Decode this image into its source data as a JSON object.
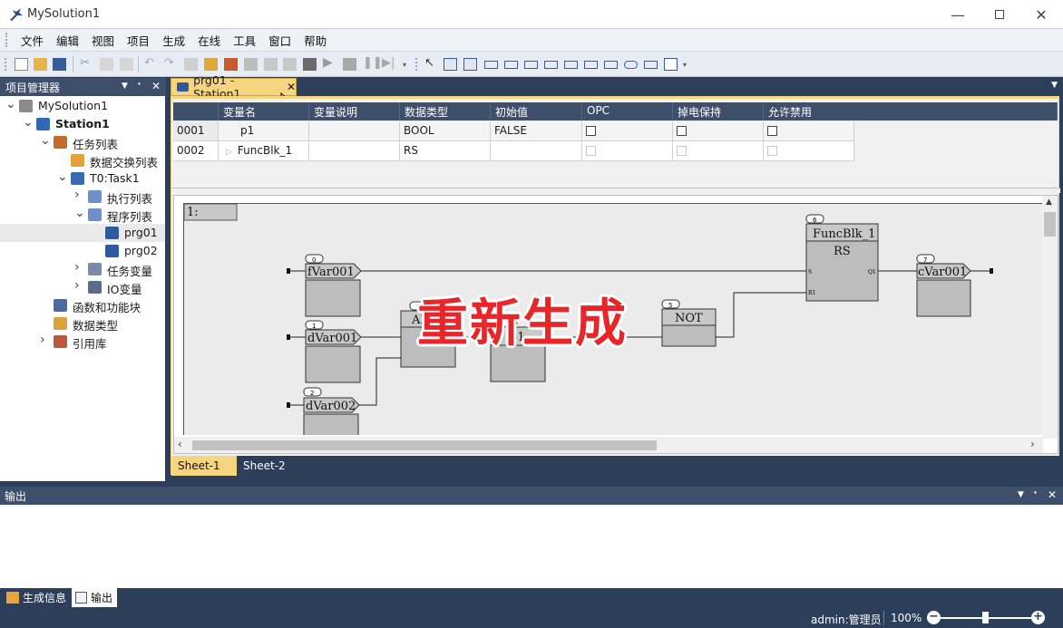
{
  "window": {
    "title": "MySolution1"
  },
  "menu": [
    "文件",
    "编辑",
    "视图",
    "项目",
    "生成",
    "在线",
    "工具",
    "窗口",
    "帮助"
  ],
  "project_panel": {
    "title": "项目管理器",
    "tree": [
      {
        "label": "MySolution1",
        "icon": "solution-icon",
        "bold": false
      },
      {
        "label": "Station1",
        "icon": "station-icon",
        "bold": true
      },
      {
        "label": "任务列表",
        "icon": "task-list-icon",
        "bold": false
      },
      {
        "label": "数据交换列表",
        "icon": "data-exchange-icon",
        "bold": false
      },
      {
        "label": "T0:Task1",
        "icon": "task-icon",
        "bold": false
      },
      {
        "label": "执行列表",
        "icon": "exec-list-icon",
        "bold": false
      },
      {
        "label": "程序列表",
        "icon": "program-list-icon",
        "bold": false
      },
      {
        "label": "prg01",
        "icon": "program-icon",
        "bold": false
      },
      {
        "label": "prg02",
        "icon": "program-icon",
        "bold": false
      },
      {
        "label": "任务变量",
        "icon": "task-variable-icon",
        "bold": false
      },
      {
        "label": "IO变量",
        "icon": "io-variable-icon",
        "bold": false
      },
      {
        "label": "函数和功能块",
        "icon": "function-block-icon",
        "bold": false
      },
      {
        "label": "数据类型",
        "icon": "data-type-icon",
        "bold": false
      },
      {
        "label": "引用库",
        "icon": "library-icon",
        "bold": false
      }
    ]
  },
  "document": {
    "tab_label": "prg01 - Station1",
    "var_table": {
      "headers": [
        "变量名",
        "变量说明",
        "数据类型",
        "初始值",
        "OPC",
        "掉电保持",
        "允许禁用"
      ],
      "rows": [
        {
          "id": "0001",
          "name": "p1",
          "desc": "",
          "type": "BOOL",
          "init": "FALSE"
        },
        {
          "id": "0002",
          "name": "FuncBlk_1",
          "desc": "",
          "type": "RS",
          "init": ""
        }
      ]
    },
    "network_label": "1:",
    "fbd": {
      "inputs": [
        {
          "num": "0",
          "name": "fVar001"
        },
        {
          "num": "1",
          "name": "dVar001"
        },
        {
          "num": "2",
          "name": "dVar002"
        }
      ],
      "blocks": [
        {
          "num": "3",
          "name": "AND"
        },
        {
          "num": "4",
          "name": "p1"
        },
        {
          "num": "5",
          "name": "NOT"
        },
        {
          "num": "6",
          "instance": "FuncBlk_1",
          "type": "RS",
          "pin_s": "S",
          "pin_r": "R1",
          "pin_q": "Q1"
        }
      ],
      "outputs": [
        {
          "num": "7",
          "name": "cVar001"
        }
      ]
    },
    "sheets": [
      "Sheet-1",
      "Sheet-2"
    ]
  },
  "output_panel": {
    "title": "输出"
  },
  "bottom_tabs": [
    "生成信息",
    "输出"
  ],
  "status": {
    "user": "admin:管理员",
    "zoom": "100%"
  },
  "overlay_text": "重新生成",
  "colors": {
    "panel_header": "#3e4f6c",
    "active_tab": "#f5d57f",
    "frame": "#2c3e5a",
    "overlay": "#e8262a"
  }
}
